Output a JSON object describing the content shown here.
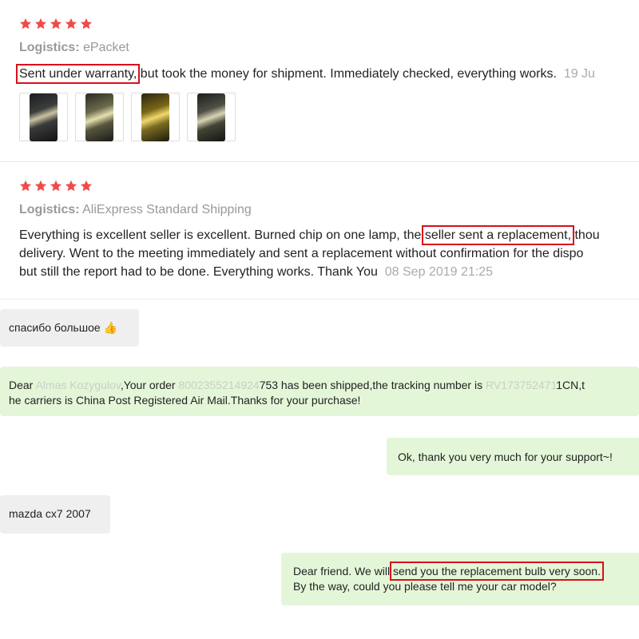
{
  "colors": {
    "star": "#f04b4b",
    "highlight": "#d8101b",
    "incoming_bubble": "#efefef",
    "outgoing_bubble": "#e4f6d8"
  },
  "review1": {
    "rating": 5,
    "logistics_label": "Logistics:",
    "logistics_value": "ePacket",
    "text_highlight": "Sent under warranty,",
    "text_rest": " but took the money for shipment. Immediately checked, everything works.",
    "date": "19 Ju",
    "photos": [
      "photo-1",
      "photo-2",
      "photo-3",
      "photo-4"
    ]
  },
  "review2": {
    "rating": 5,
    "logistics_label": "Logistics:",
    "logistics_value": "AliExpress Standard Shipping",
    "line1_before": "Everything is excellent seller is excellent. Burned chip on one lamp, the ",
    "line1_highlight": "seller sent a replacement,",
    "line1_after": " thou",
    "line2": "delivery. Went to the meeting immediately and sent a replacement without confirmation for the dispo",
    "line3": "but still the report had to be done. Everything works. Thank You",
    "date": "08 Sep 2019 21:25"
  },
  "chat": {
    "msg1": {
      "text": "спасибо большое",
      "emoji": "👍"
    },
    "msg2": {
      "p1": "Dear ",
      "name_blurred": "Almas Kozygulov",
      "p2": ",Your order ",
      "order_blurred": "8002355214924",
      "p3": "753 has been shipped,the tracking number is ",
      "tracking_blurred": "RV173752471",
      "p4": "1CN,t",
      "line2": "he carriers is China Post Registered Air Mail.Thanks for your purchase!"
    },
    "msg3": {
      "text": "Ok, thank you very much for your support~!"
    },
    "msg4": {
      "text": "mazda cx7 2007"
    },
    "msg5": {
      "before": "Dear friend. We will ",
      "highlight": "send you the replacement bulb very soon.",
      "line2": "By the way, could you please tell me your car model?"
    }
  }
}
